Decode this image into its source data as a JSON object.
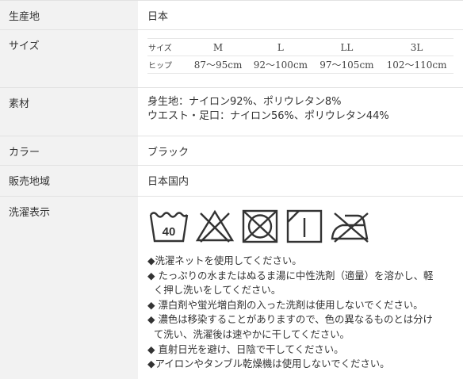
{
  "rows": {
    "origin": {
      "label": "生産地",
      "value": "日本"
    },
    "size": {
      "label": "サイズ",
      "table": {
        "header_label": "サイズ",
        "sizes": [
          "M",
          "L",
          "LL",
          "3L"
        ],
        "hip_label": "ヒップ",
        "hips": [
          "87～95cm",
          "92～100cm",
          "97～105cm",
          "102～110cm"
        ]
      }
    },
    "material": {
      "label": "素材",
      "lines": [
        "身生地：ナイロン92%、ポリウレタン8%",
        "ウエスト・足口：ナイロン56%、ポリウレタン44%"
      ]
    },
    "color": {
      "label": "カラー",
      "value": "ブラック"
    },
    "area": {
      "label": "販売地域",
      "value": "日本国内"
    },
    "wash": {
      "label": "洗濯表示",
      "wash_temp": "40",
      "icons": [
        "wash-40-icon",
        "no-bleach-icon",
        "no-tumble-dry-icon",
        "drip-dry-shade-icon",
        "no-iron-icon"
      ],
      "notes": [
        "◆洗濯ネットを使用してください。",
        "◆ たっぷりの水またはぬるま湯に中性洗剤（適量）を溶かし、軽",
        "  く押し洗いをしてください。",
        "◆ 漂白剤や蛍光増白剤の入った洗剤は使用しないでください。",
        "◆ 濃色は移染することがありますので、色の異なるものとは分け",
        "  て洗い、洗濯後は速やかに干してください。",
        "◆ 直射日光を避け、日陰で干してください。",
        "◆アイロンやタンブル乾燥機は使用しないでください。"
      ]
    }
  }
}
